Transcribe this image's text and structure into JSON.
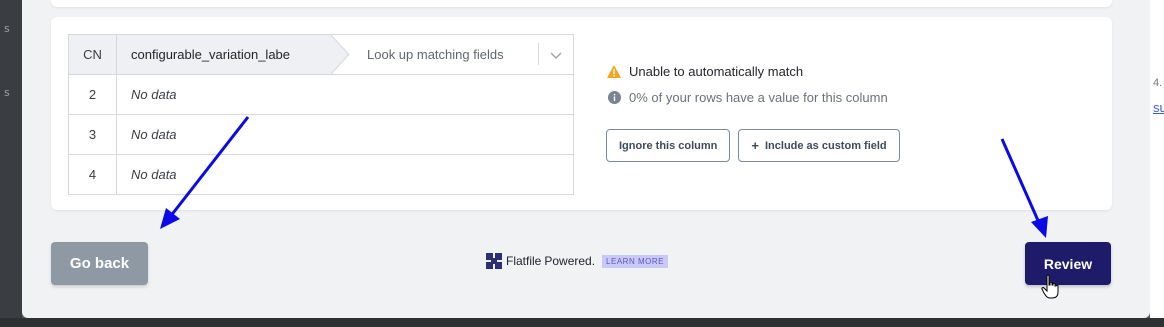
{
  "background": {
    "left_strip_glyphs": [
      "s",
      "s"
    ],
    "right_edge_texts": [
      "4.",
      "su"
    ]
  },
  "table": {
    "header": {
      "number": "CN",
      "column_name": "configurable_variation_labe",
      "lookup_placeholder": "Look up matching fields"
    },
    "rows": [
      {
        "number": "2",
        "value": "No data"
      },
      {
        "number": "3",
        "value": "No data"
      },
      {
        "number": "4",
        "value": "No data"
      }
    ]
  },
  "status": {
    "warning_text": "Unable to automatically match",
    "info_text": "0% of your rows have a value for this column",
    "warning_color": "#f4a619",
    "info_color": "#7b848e"
  },
  "actions": {
    "ignore_label": "Ignore this column",
    "include_label": "Include as custom field",
    "include_icon": "plus-icon"
  },
  "footer": {
    "go_back_label": "Go back",
    "review_label": "Review",
    "brand_name": "Flatfile",
    "powered_text": "Powered.",
    "learn_more_label": "LEARN MORE"
  },
  "colors": {
    "review_bg": "#1f1b6b",
    "go_back_bg": "#8e99a4",
    "annotation_arrow": "#0a0ae6"
  }
}
